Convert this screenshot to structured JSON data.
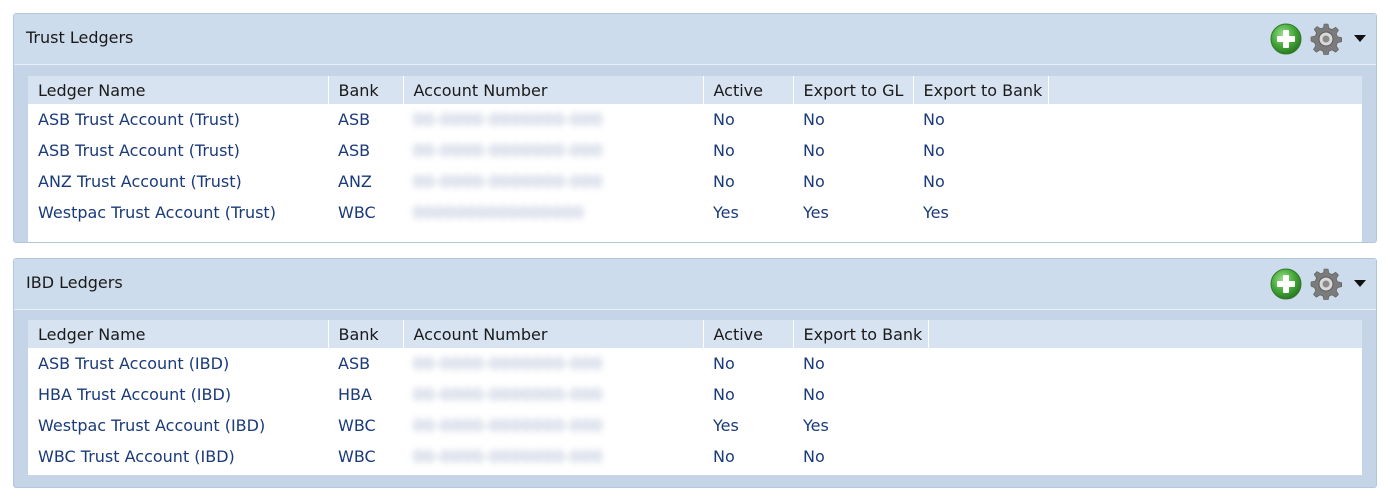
{
  "trust": {
    "title": "Trust Ledgers",
    "columns": {
      "ledger_name": "Ledger Name",
      "bank": "Bank",
      "account_number": "Account Number",
      "active": "Active",
      "export_gl": "Export to GL",
      "export_bank": "Export to Bank"
    },
    "rows": [
      {
        "ledger_name": "ASB Trust Account (Trust)",
        "bank": "ASB",
        "account_number": "00-0000-0000000-000",
        "active": "No",
        "export_gl": "No",
        "export_bank": "No"
      },
      {
        "ledger_name": "ASB Trust Account (Trust)",
        "bank": "ASB",
        "account_number": "00-0000-0000000-000",
        "active": "No",
        "export_gl": "No",
        "export_bank": "No"
      },
      {
        "ledger_name": "ANZ Trust Account (Trust)",
        "bank": "ANZ",
        "account_number": "00-0000-0000000-000",
        "active": "No",
        "export_gl": "No",
        "export_bank": "No"
      },
      {
        "ledger_name": "Westpac Trust Account (Trust)",
        "bank": "WBC",
        "account_number": "0000000000000000",
        "active": "Yes",
        "export_gl": "Yes",
        "export_bank": "Yes"
      }
    ]
  },
  "ibd": {
    "title": "IBD Ledgers",
    "columns": {
      "ledger_name": "Ledger Name",
      "bank": "Bank",
      "account_number": "Account Number",
      "active": "Active",
      "export_bank": "Export to Bank"
    },
    "rows": [
      {
        "ledger_name": "ASB Trust Account (IBD)",
        "bank": "ASB",
        "account_number": "00-0000-0000000-000",
        "active": "No",
        "export_bank": "No"
      },
      {
        "ledger_name": "HBA Trust Account (IBD)",
        "bank": "HBA",
        "account_number": "00-0000-0000000-000",
        "active": "No",
        "export_bank": "No"
      },
      {
        "ledger_name": "Westpac Trust Account (IBD)",
        "bank": "WBC",
        "account_number": "00-0000-0000000-000",
        "active": "Yes",
        "export_bank": "Yes"
      },
      {
        "ledger_name": "WBC Trust Account (IBD)",
        "bank": "WBC",
        "account_number": "00-0000-0000000-000",
        "active": "No",
        "export_bank": "No"
      }
    ]
  },
  "icons": {
    "add": "plus-circle-green",
    "settings": "gear",
    "collapse": "caret-down"
  }
}
